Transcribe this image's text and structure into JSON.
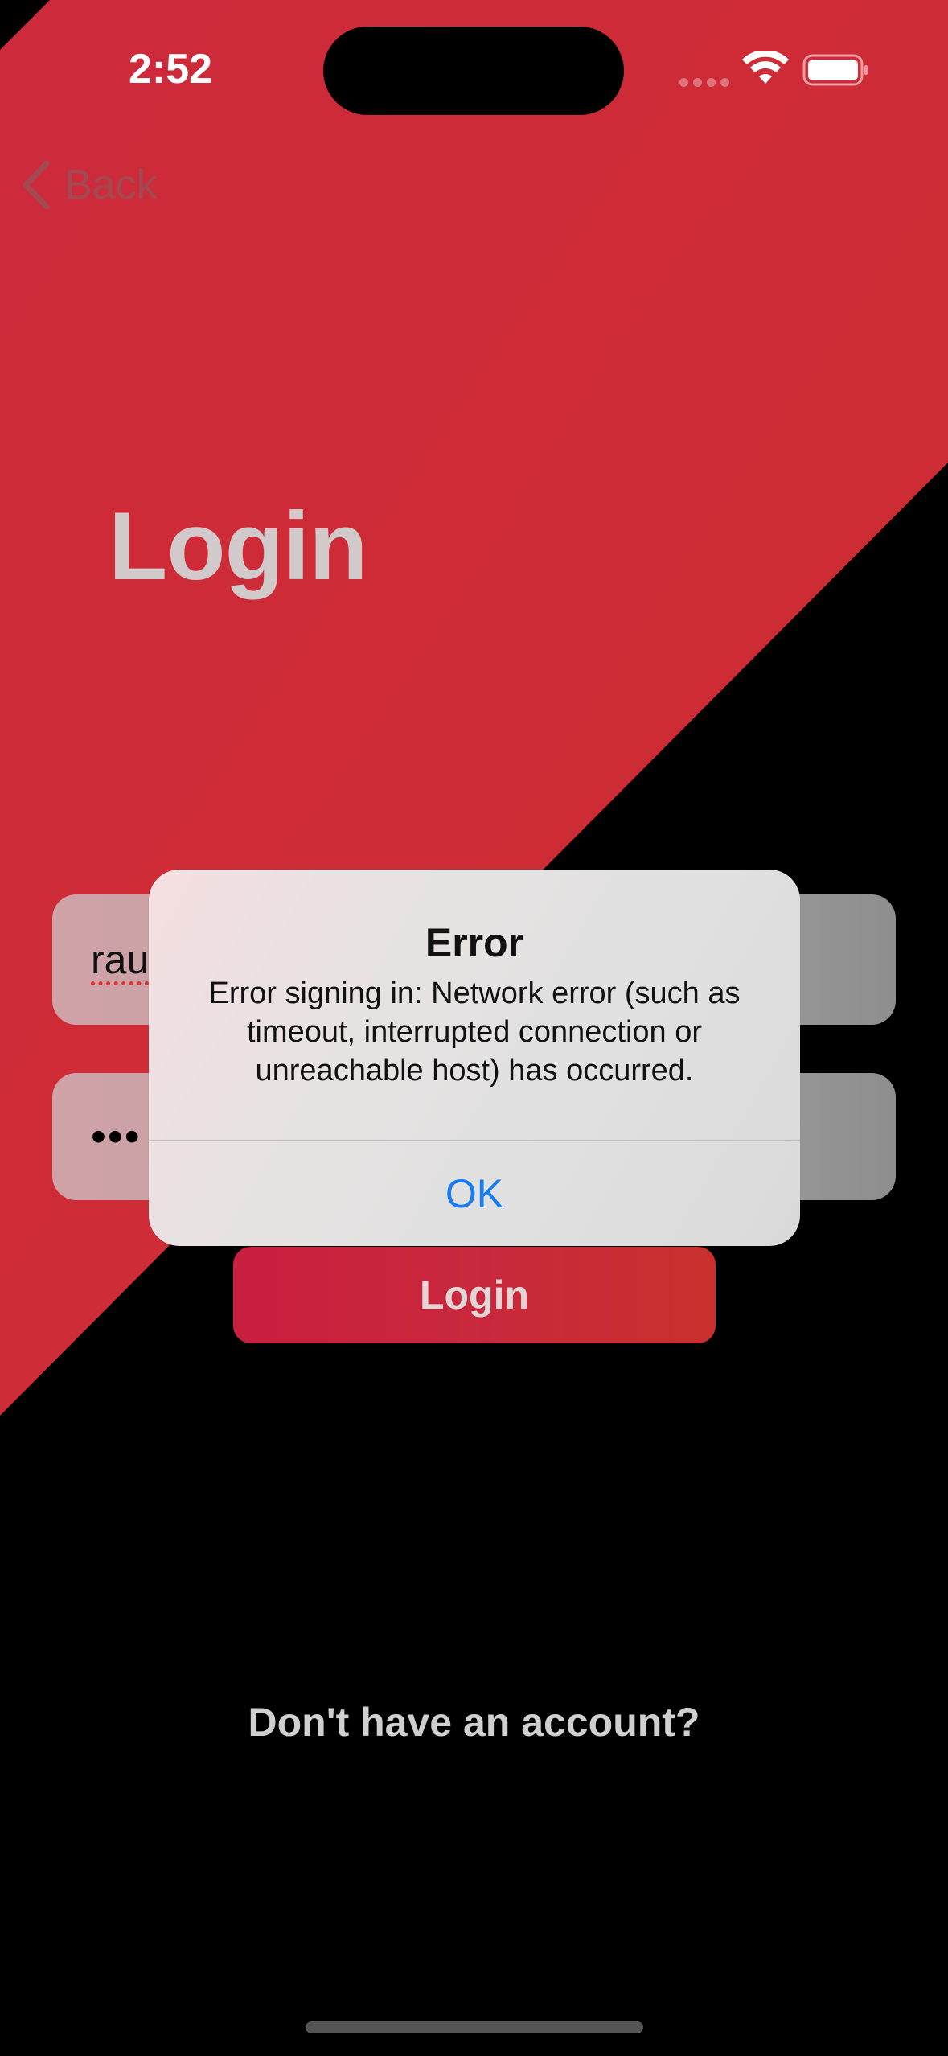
{
  "status_bar": {
    "time": "2:52"
  },
  "nav": {
    "back_label": "Back"
  },
  "page": {
    "title": "Login"
  },
  "form": {
    "username_value": "rau",
    "password_value": "•••",
    "login_button_label": "Login"
  },
  "footer": {
    "signup_prompt": "Don't have an account?"
  },
  "alert": {
    "title": "Error",
    "message": "Error signing in: Network error (such as timeout, interrupted connection or unreachable host) has occurred.",
    "ok_label": "OK"
  },
  "colors": {
    "accent_red": "#cf2a38",
    "alert_button_blue": "#1a7cf3",
    "background": "#000000"
  },
  "icons": {
    "back": "chevron-left-icon",
    "wifi": "wifi-icon",
    "battery": "battery-icon"
  }
}
